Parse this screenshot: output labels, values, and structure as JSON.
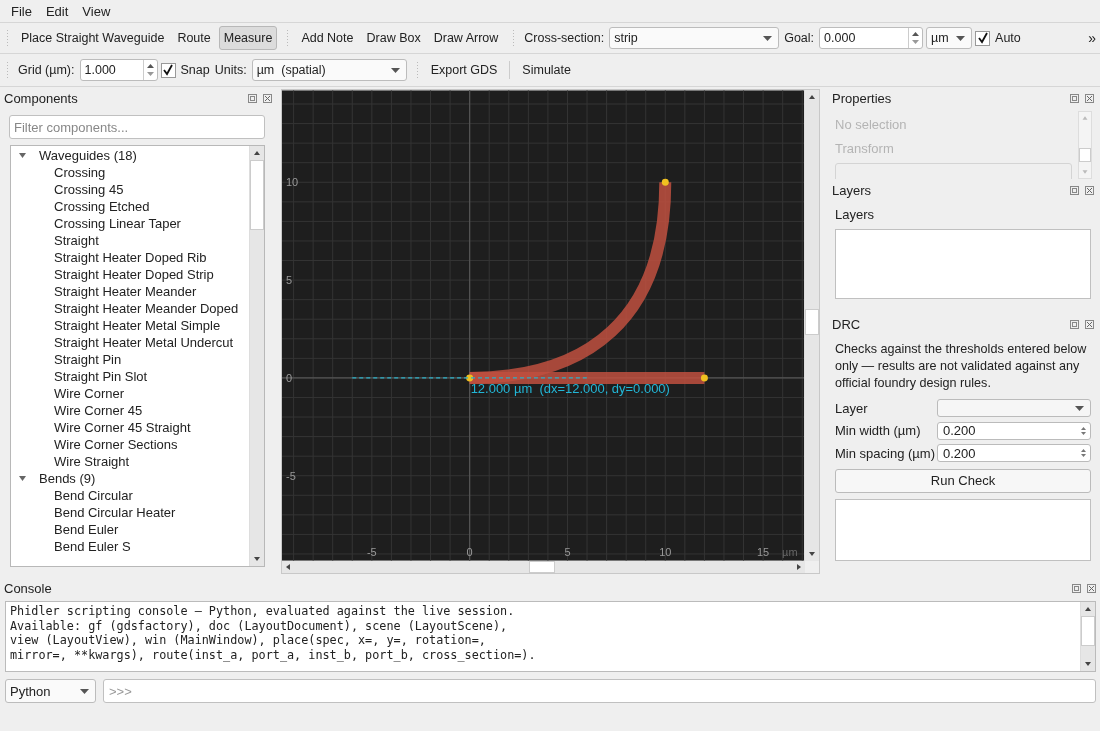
{
  "menu": [
    {
      "label": "File"
    },
    {
      "label": "Edit"
    },
    {
      "label": "View"
    }
  ],
  "toolbars": [
    {
      "groups": [
        [
          {
            "kind": "button",
            "label": "Place Straight Waveguide",
            "selected": false
          },
          {
            "kind": "button",
            "label": "Route",
            "selected": false
          },
          {
            "kind": "button",
            "label": "Measure",
            "selected": true
          }
        ],
        [
          {
            "kind": "button",
            "label": "Add Note",
            "selected": false
          },
          {
            "kind": "button",
            "label": "Draw Box",
            "selected": false
          },
          {
            "kind": "button",
            "label": "Draw Arrow",
            "selected": false
          }
        ],
        [
          {
            "kind": "label",
            "label": "Cross-section:"
          },
          {
            "kind": "combo",
            "value": "strip"
          },
          {
            "kind": "label",
            "label": "Goal:"
          },
          {
            "kind": "spin",
            "value": "0.000"
          },
          {
            "kind": "combo",
            "value": "µm"
          },
          {
            "kind": "checkbox",
            "label": "Auto",
            "checked": true
          }
        ]
      ],
      "overflow": "»"
    },
    {
      "groups": [
        [
          {
            "kind": "label",
            "label": "Grid (µm):"
          },
          {
            "kind": "spin",
            "value": "1.000"
          },
          {
            "kind": "checkbox",
            "label": "Snap",
            "checked": true
          },
          {
            "kind": "label",
            "label": "Units:"
          },
          {
            "kind": "combo",
            "value": "µm  (spatial)"
          }
        ],
        [
          {
            "kind": "button",
            "label": "Export GDS",
            "selected": false
          },
          {
            "kind": "separator"
          },
          {
            "kind": "button",
            "label": "Simulate",
            "selected": false
          }
        ]
      ]
    }
  ],
  "components": {
    "title": "Components",
    "filter_placeholder": "Filter components...",
    "tree": [
      {
        "label": "Waveguides (18)",
        "expanded": true,
        "selected": false,
        "children": [
          {
            "label": "Crossing",
            "selected": false
          },
          {
            "label": "Crossing 45",
            "selected": false
          },
          {
            "label": "Crossing Etched",
            "selected": false
          },
          {
            "label": "Crossing Linear Taper",
            "selected": false
          },
          {
            "label": "Straight",
            "selected": false
          },
          {
            "label": "Straight Heater Doped Rib",
            "selected": false
          },
          {
            "label": "Straight Heater Doped Strip",
            "selected": false
          },
          {
            "label": "Straight Heater Meander",
            "selected": false
          },
          {
            "label": "Straight Heater Meander Doped",
            "selected": false
          },
          {
            "label": "Straight Heater Metal Simple",
            "selected": false
          },
          {
            "label": "Straight Heater Metal Undercut",
            "selected": false
          },
          {
            "label": "Straight Pin",
            "selected": false
          },
          {
            "label": "Straight Pin Slot",
            "selected": false
          },
          {
            "label": "Wire Corner",
            "selected": false
          },
          {
            "label": "Wire Corner 45",
            "selected": false
          },
          {
            "label": "Wire Corner 45 Straight",
            "selected": false
          },
          {
            "label": "Wire Corner Sections",
            "selected": false
          },
          {
            "label": "Wire Straight",
            "selected": false
          }
        ]
      },
      {
        "label": "Bends (9)",
        "expanded": true,
        "selected": false,
        "children": [
          {
            "label": "Bend Circular",
            "selected": false
          },
          {
            "label": "Bend Circular Heater",
            "selected": false
          },
          {
            "label": "Bend Euler",
            "selected": false
          },
          {
            "label": "Bend Euler S",
            "selected": false
          }
        ]
      }
    ]
  },
  "canvas": {
    "x_ticks": [
      "-5",
      "0",
      "5",
      "10",
      "15"
    ],
    "unit": "µm",
    "y_ticks": [
      "10",
      "5",
      "0",
      "-5"
    ],
    "measure_label": "12.000 µm  (dx=12.000, dy=0.000)"
  },
  "properties": {
    "title": "Properties",
    "items": [
      {
        "label": "No selection",
        "disabled": true
      },
      {
        "label": "Transform",
        "disabled": true
      }
    ]
  },
  "layers": {
    "title": "Layers",
    "label": "Layers"
  },
  "drc": {
    "title": "DRC",
    "description": "Checks against the thresholds entered below only — results are not validated against any official foundry design rules.",
    "fields": [
      {
        "kind": "combo",
        "label": "Layer"
      },
      {
        "kind": "spin",
        "label": "Min width (µm)",
        "value": "0.200"
      },
      {
        "kind": "spin",
        "label": "Min spacing (µm)",
        "value": "0.200"
      }
    ],
    "run_button": "Run Check"
  },
  "console": {
    "title": "Console",
    "lines": [
      "Phidler scripting console — Python, evaluated against the live session.",
      "Available: gf (gdsfactory), doc (LayoutDocument), scene (LayoutScene),",
      "view (LayoutView), win (MainWindow), place(spec, x=, y=, rotation=,",
      "mirror=, **kwargs), route(inst_a, port_a, inst_b, port_b, cross_section=)."
    ],
    "language": "Python",
    "input_placeholder": ">>>"
  }
}
